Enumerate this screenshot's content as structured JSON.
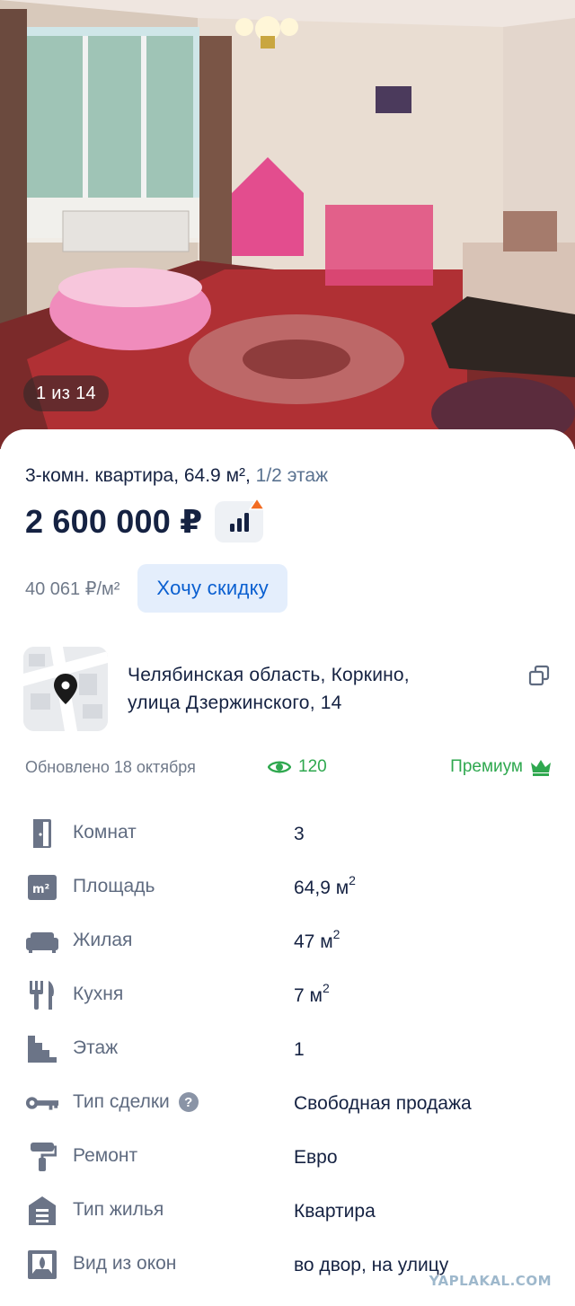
{
  "gallery": {
    "counter": "1 из 14"
  },
  "listing": {
    "subtitle_main": "3-комн. квартира, 64.9 м², ",
    "subtitle_floor": "1/2 этаж",
    "price": "2 600 000 ₽",
    "price_per_meter": "40 061 ₽/м²",
    "discount_button": "Хочу скидку",
    "stats_icon": "bar-chart-icon"
  },
  "address": {
    "line1": "Челябинская область, Коркино,",
    "line2": "улица Дзержинского, 14",
    "copy_icon": "copy-icon",
    "map_icon": "map-pin-icon"
  },
  "meta": {
    "updated": "Обновлено 18 октября",
    "views": "120",
    "premium": "Премиум"
  },
  "params": [
    {
      "icon": "door-icon",
      "label": "Комнат",
      "value": "3",
      "unit": ""
    },
    {
      "icon": "square-meter-icon",
      "label": "Площадь",
      "value": "64,9 м",
      "unit": "2"
    },
    {
      "icon": "sofa-icon",
      "label": "Жилая",
      "value": "47 м",
      "unit": "2"
    },
    {
      "icon": "fork-knife-icon",
      "label": "Кухня",
      "value": "7 м",
      "unit": "2"
    },
    {
      "icon": "stairs-icon",
      "label": "Этаж",
      "value": "1",
      "unit": ""
    },
    {
      "icon": "key-icon",
      "label": "Тип сделки",
      "value": "Свободная продажа",
      "unit": ""
    },
    {
      "icon": "paint-roller-icon",
      "label": "Ремонт",
      "value": "Евро",
      "unit": ""
    },
    {
      "icon": "building-icon",
      "label": "Тип жилья",
      "value": "Квартира",
      "unit": ""
    },
    {
      "icon": "window-view-icon",
      "label": "Вид из окон",
      "value": "во двор, на улицу",
      "unit": ""
    }
  ],
  "watermark": "YAPLAKAL.COM",
  "colors": {
    "primary_text": "#152242",
    "secondary_text": "#707a8a",
    "link_blue": "#0a5fd0",
    "green": "#2fa84f",
    "orange_dot": "#f26b21"
  }
}
